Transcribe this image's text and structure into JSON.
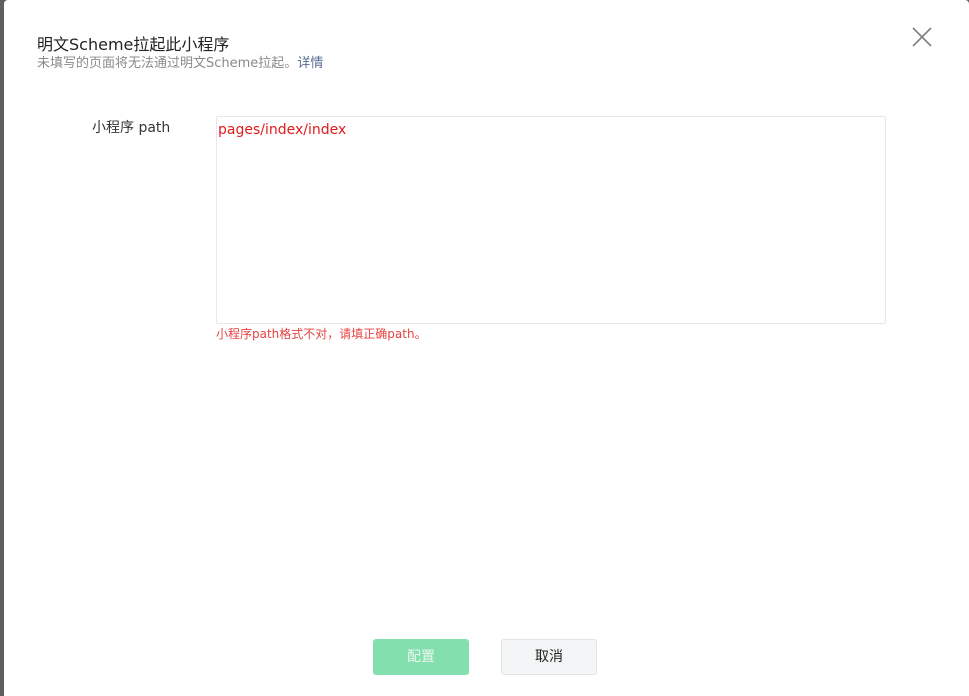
{
  "dialog": {
    "title": "明文Scheme拉起此小程序",
    "subtitle": "未填写的页面将无法通过明文Scheme拉起。",
    "subtitle_link": "详情",
    "close_icon": "close-icon"
  },
  "form": {
    "path_label": "小程序 path",
    "path_value": "pages/index/index",
    "error_message": "小程序path格式不对，请填正确path。"
  },
  "footer": {
    "confirm_label": "配置",
    "cancel_label": "取消"
  },
  "colors": {
    "primary_disabled": "#84dfaf",
    "error": "#e64340",
    "link": "#576b95"
  }
}
